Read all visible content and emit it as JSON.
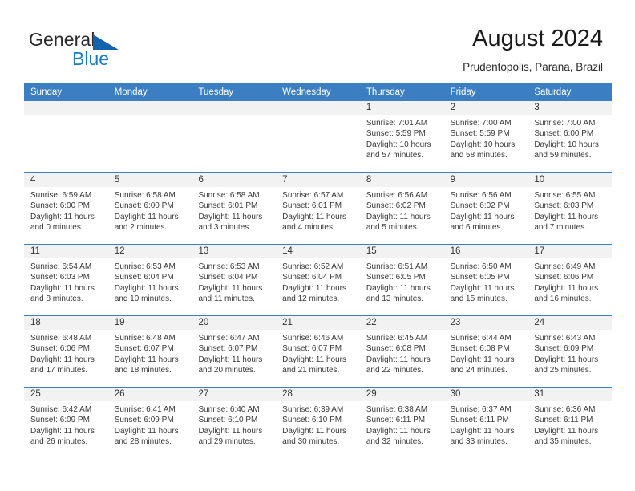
{
  "brand": {
    "name_part1": "General",
    "name_part2": "Blue",
    "accent_color": "#1d7ac4",
    "triangle_color": "#1263ad"
  },
  "header": {
    "month_title": "August 2024",
    "location": "Prudentopolis, Parana, Brazil"
  },
  "calendar": {
    "header_bg": "#3b7ec1",
    "day_names": [
      "Sunday",
      "Monday",
      "Tuesday",
      "Wednesday",
      "Thursday",
      "Friday",
      "Saturday"
    ],
    "weeks": [
      [
        {
          "date": "",
          "empty": true
        },
        {
          "date": "",
          "empty": true
        },
        {
          "date": "",
          "empty": true
        },
        {
          "date": "",
          "empty": true
        },
        {
          "date": "1",
          "sunrise": "Sunrise: 7:01 AM",
          "sunset": "Sunset: 5:59 PM",
          "daylight_line1": "Daylight: 10 hours",
          "daylight_line2": "and 57 minutes."
        },
        {
          "date": "2",
          "sunrise": "Sunrise: 7:00 AM",
          "sunset": "Sunset: 5:59 PM",
          "daylight_line1": "Daylight: 10 hours",
          "daylight_line2": "and 58 minutes."
        },
        {
          "date": "3",
          "sunrise": "Sunrise: 7:00 AM",
          "sunset": "Sunset: 6:00 PM",
          "daylight_line1": "Daylight: 10 hours",
          "daylight_line2": "and 59 minutes."
        }
      ],
      [
        {
          "date": "4",
          "sunrise": "Sunrise: 6:59 AM",
          "sunset": "Sunset: 6:00 PM",
          "daylight_line1": "Daylight: 11 hours",
          "daylight_line2": "and 0 minutes."
        },
        {
          "date": "5",
          "sunrise": "Sunrise: 6:58 AM",
          "sunset": "Sunset: 6:00 PM",
          "daylight_line1": "Daylight: 11 hours",
          "daylight_line2": "and 2 minutes."
        },
        {
          "date": "6",
          "sunrise": "Sunrise: 6:58 AM",
          "sunset": "Sunset: 6:01 PM",
          "daylight_line1": "Daylight: 11 hours",
          "daylight_line2": "and 3 minutes."
        },
        {
          "date": "7",
          "sunrise": "Sunrise: 6:57 AM",
          "sunset": "Sunset: 6:01 PM",
          "daylight_line1": "Daylight: 11 hours",
          "daylight_line2": "and 4 minutes."
        },
        {
          "date": "8",
          "sunrise": "Sunrise: 6:56 AM",
          "sunset": "Sunset: 6:02 PM",
          "daylight_line1": "Daylight: 11 hours",
          "daylight_line2": "and 5 minutes."
        },
        {
          "date": "9",
          "sunrise": "Sunrise: 6:56 AM",
          "sunset": "Sunset: 6:02 PM",
          "daylight_line1": "Daylight: 11 hours",
          "daylight_line2": "and 6 minutes."
        },
        {
          "date": "10",
          "sunrise": "Sunrise: 6:55 AM",
          "sunset": "Sunset: 6:03 PM",
          "daylight_line1": "Daylight: 11 hours",
          "daylight_line2": "and 7 minutes."
        }
      ],
      [
        {
          "date": "11",
          "sunrise": "Sunrise: 6:54 AM",
          "sunset": "Sunset: 6:03 PM",
          "daylight_line1": "Daylight: 11 hours",
          "daylight_line2": "and 8 minutes."
        },
        {
          "date": "12",
          "sunrise": "Sunrise: 6:53 AM",
          "sunset": "Sunset: 6:04 PM",
          "daylight_line1": "Daylight: 11 hours",
          "daylight_line2": "and 10 minutes."
        },
        {
          "date": "13",
          "sunrise": "Sunrise: 6:53 AM",
          "sunset": "Sunset: 6:04 PM",
          "daylight_line1": "Daylight: 11 hours",
          "daylight_line2": "and 11 minutes."
        },
        {
          "date": "14",
          "sunrise": "Sunrise: 6:52 AM",
          "sunset": "Sunset: 6:04 PM",
          "daylight_line1": "Daylight: 11 hours",
          "daylight_line2": "and 12 minutes."
        },
        {
          "date": "15",
          "sunrise": "Sunrise: 6:51 AM",
          "sunset": "Sunset: 6:05 PM",
          "daylight_line1": "Daylight: 11 hours",
          "daylight_line2": "and 13 minutes."
        },
        {
          "date": "16",
          "sunrise": "Sunrise: 6:50 AM",
          "sunset": "Sunset: 6:05 PM",
          "daylight_line1": "Daylight: 11 hours",
          "daylight_line2": "and 15 minutes."
        },
        {
          "date": "17",
          "sunrise": "Sunrise: 6:49 AM",
          "sunset": "Sunset: 6:06 PM",
          "daylight_line1": "Daylight: 11 hours",
          "daylight_line2": "and 16 minutes."
        }
      ],
      [
        {
          "date": "18",
          "sunrise": "Sunrise: 6:48 AM",
          "sunset": "Sunset: 6:06 PM",
          "daylight_line1": "Daylight: 11 hours",
          "daylight_line2": "and 17 minutes."
        },
        {
          "date": "19",
          "sunrise": "Sunrise: 6:48 AM",
          "sunset": "Sunset: 6:07 PM",
          "daylight_line1": "Daylight: 11 hours",
          "daylight_line2": "and 18 minutes."
        },
        {
          "date": "20",
          "sunrise": "Sunrise: 6:47 AM",
          "sunset": "Sunset: 6:07 PM",
          "daylight_line1": "Daylight: 11 hours",
          "daylight_line2": "and 20 minutes."
        },
        {
          "date": "21",
          "sunrise": "Sunrise: 6:46 AM",
          "sunset": "Sunset: 6:07 PM",
          "daylight_line1": "Daylight: 11 hours",
          "daylight_line2": "and 21 minutes."
        },
        {
          "date": "22",
          "sunrise": "Sunrise: 6:45 AM",
          "sunset": "Sunset: 6:08 PM",
          "daylight_line1": "Daylight: 11 hours",
          "daylight_line2": "and 22 minutes."
        },
        {
          "date": "23",
          "sunrise": "Sunrise: 6:44 AM",
          "sunset": "Sunset: 6:08 PM",
          "daylight_line1": "Daylight: 11 hours",
          "daylight_line2": "and 24 minutes."
        },
        {
          "date": "24",
          "sunrise": "Sunrise: 6:43 AM",
          "sunset": "Sunset: 6:09 PM",
          "daylight_line1": "Daylight: 11 hours",
          "daylight_line2": "and 25 minutes."
        }
      ],
      [
        {
          "date": "25",
          "sunrise": "Sunrise: 6:42 AM",
          "sunset": "Sunset: 6:09 PM",
          "daylight_line1": "Daylight: 11 hours",
          "daylight_line2": "and 26 minutes."
        },
        {
          "date": "26",
          "sunrise": "Sunrise: 6:41 AM",
          "sunset": "Sunset: 6:09 PM",
          "daylight_line1": "Daylight: 11 hours",
          "daylight_line2": "and 28 minutes."
        },
        {
          "date": "27",
          "sunrise": "Sunrise: 6:40 AM",
          "sunset": "Sunset: 6:10 PM",
          "daylight_line1": "Daylight: 11 hours",
          "daylight_line2": "and 29 minutes."
        },
        {
          "date": "28",
          "sunrise": "Sunrise: 6:39 AM",
          "sunset": "Sunset: 6:10 PM",
          "daylight_line1": "Daylight: 11 hours",
          "daylight_line2": "and 30 minutes."
        },
        {
          "date": "29",
          "sunrise": "Sunrise: 6:38 AM",
          "sunset": "Sunset: 6:11 PM",
          "daylight_line1": "Daylight: 11 hours",
          "daylight_line2": "and 32 minutes."
        },
        {
          "date": "30",
          "sunrise": "Sunrise: 6:37 AM",
          "sunset": "Sunset: 6:11 PM",
          "daylight_line1": "Daylight: 11 hours",
          "daylight_line2": "and 33 minutes."
        },
        {
          "date": "31",
          "sunrise": "Sunrise: 6:36 AM",
          "sunset": "Sunset: 6:11 PM",
          "daylight_line1": "Daylight: 11 hours",
          "daylight_line2": "and 35 minutes."
        }
      ]
    ]
  }
}
